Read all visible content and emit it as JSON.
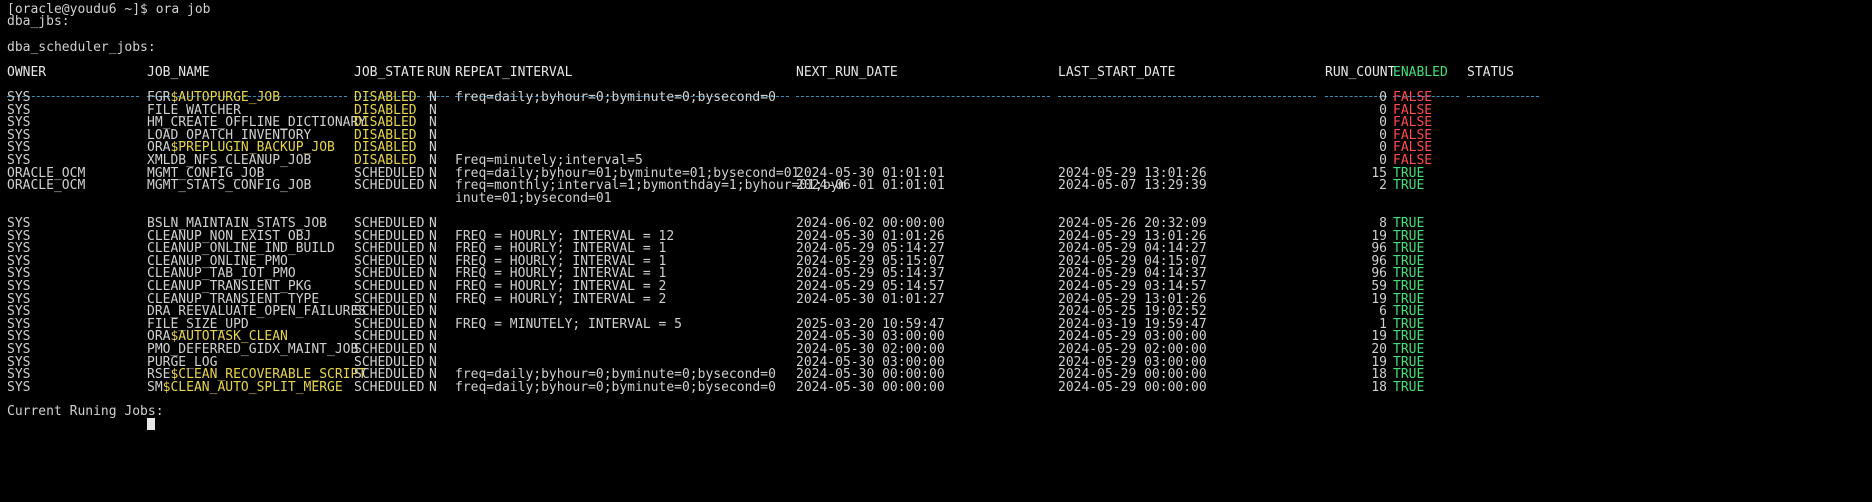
{
  "terminal": {
    "prompt": "[oracle@youdu6 ~]$ ora job",
    "heading_jbs": "dba_jbs:",
    "heading_scheduler": "dba_scheduler_jobs:",
    "footer": "Current Runing Jobs:"
  },
  "colors": {
    "background": "#000000",
    "text": "#d0d0d0",
    "disabled": "#e6d44a",
    "false": "#ff4b4b",
    "true": "#3fe07a",
    "separator": "#3a8fb8"
  },
  "columns": {
    "owner": "OWNER",
    "job_name": "JOB_NAME",
    "job_state": "JOB_STATE",
    "run": "RUN",
    "repeat_interval": "REPEAT_INTERVAL",
    "next_run_date": "NEXT_RUN_DATE",
    "last_start_date": "LAST_START_DATE",
    "run_count": "RUN_COUNT",
    "enabled": "ENABLED",
    "status": "STATUS"
  },
  "rows": [
    {
      "owner": "SYS",
      "job_prefix": "FGR",
      "job_suffix": "$AUTOPURGE_JOB",
      "state": "DISABLED",
      "run": "N",
      "repeat": "freq=daily;byhour=0;byminute=0;bysecond=0",
      "next": "",
      "last": "",
      "count": "0",
      "enabled": "FALSE"
    },
    {
      "owner": "SYS",
      "job_prefix": "FILE_WATCHER",
      "job_suffix": "",
      "state": "DISABLED",
      "run": "N",
      "repeat": "",
      "next": "",
      "last": "",
      "count": "0",
      "enabled": "FALSE"
    },
    {
      "owner": "SYS",
      "job_prefix": "HM_CREATE_OFFLINE_DICTIONARY",
      "job_suffix": "",
      "state": "DISABLED",
      "run": "N",
      "repeat": "",
      "next": "",
      "last": "",
      "count": "0",
      "enabled": "FALSE"
    },
    {
      "owner": "SYS",
      "job_prefix": "LOAD_OPATCH_INVENTORY",
      "job_suffix": "",
      "state": "DISABLED",
      "run": "N",
      "repeat": "",
      "next": "",
      "last": "",
      "count": "0",
      "enabled": "FALSE"
    },
    {
      "owner": "SYS",
      "job_prefix": "ORA",
      "job_suffix": "$PREPLUGIN_BACKUP_JOB",
      "state": "DISABLED",
      "run": "N",
      "repeat": "",
      "next": "",
      "last": "",
      "count": "0",
      "enabled": "FALSE"
    },
    {
      "owner": "SYS",
      "job_prefix": "XMLDB_NFS_CLEANUP_JOB",
      "job_suffix": "",
      "state": "DISABLED",
      "run": "N",
      "repeat": "Freq=minutely;interval=5",
      "next": "",
      "last": "",
      "count": "0",
      "enabled": "FALSE"
    },
    {
      "owner": "ORACLE_OCM",
      "job_prefix": "MGMT_CONFIG_JOB",
      "job_suffix": "",
      "state": "SCHEDULED",
      "run": "N",
      "repeat": "freq=daily;byhour=01;byminute=01;bysecond=01",
      "next": "2024-05-30 01:01:01",
      "last": "2024-05-29 13:01:26",
      "count": "15",
      "enabled": "TRUE"
    },
    {
      "owner": "ORACLE_OCM",
      "job_prefix": "MGMT_STATS_CONFIG_JOB",
      "job_suffix": "",
      "state": "SCHEDULED",
      "run": "N",
      "repeat": "freq=monthly;interval=1;bymonthday=1;byhour=01;bym",
      "repeat2": "inute=01;bysecond=01",
      "next": "2024-06-01 01:01:01",
      "last": "2024-05-07 13:29:39",
      "count": "2",
      "enabled": "TRUE"
    },
    {
      "owner": "SYS",
      "job_prefix": "BSLN_MAINTAIN_STATS_JOB",
      "job_suffix": "",
      "state": "SCHEDULED",
      "run": "N",
      "repeat": "",
      "next": "2024-06-02 00:00:00",
      "last": "2024-05-26 20:32:09",
      "count": "8",
      "enabled": "TRUE"
    },
    {
      "owner": "SYS",
      "job_prefix": "CLEANUP_NON_EXIST_OBJ",
      "job_suffix": "",
      "state": "SCHEDULED",
      "run": "N",
      "repeat": "FREQ = HOURLY; INTERVAL = 12",
      "next": "2024-05-30 01:01:26",
      "last": "2024-05-29 13:01:26",
      "count": "19",
      "enabled": "TRUE"
    },
    {
      "owner": "SYS",
      "job_prefix": "CLEANUP_ONLINE_IND_BUILD",
      "job_suffix": "",
      "state": "SCHEDULED",
      "run": "N",
      "repeat": "FREQ = HOURLY; INTERVAL = 1",
      "next": "2024-05-29 05:14:27",
      "last": "2024-05-29 04:14:27",
      "count": "96",
      "enabled": "TRUE"
    },
    {
      "owner": "SYS",
      "job_prefix": "CLEANUP_ONLINE_PMO",
      "job_suffix": "",
      "state": "SCHEDULED",
      "run": "N",
      "repeat": "FREQ = HOURLY; INTERVAL = 1",
      "next": "2024-05-29 05:15:07",
      "last": "2024-05-29 04:15:07",
      "count": "96",
      "enabled": "TRUE"
    },
    {
      "owner": "SYS",
      "job_prefix": "CLEANUP_TAB_IOT_PMO",
      "job_suffix": "",
      "state": "SCHEDULED",
      "run": "N",
      "repeat": "FREQ = HOURLY; INTERVAL = 1",
      "next": "2024-05-29 05:14:37",
      "last": "2024-05-29 04:14:37",
      "count": "96",
      "enabled": "TRUE"
    },
    {
      "owner": "SYS",
      "job_prefix": "CLEANUP_TRANSIENT_PKG",
      "job_suffix": "",
      "state": "SCHEDULED",
      "run": "N",
      "repeat": "FREQ = HOURLY; INTERVAL = 2",
      "next": "2024-05-29 05:14:57",
      "last": "2024-05-29 03:14:57",
      "count": "59",
      "enabled": "TRUE"
    },
    {
      "owner": "SYS",
      "job_prefix": "CLEANUP_TRANSIENT_TYPE",
      "job_suffix": "",
      "state": "SCHEDULED",
      "run": "N",
      "repeat": "FREQ = HOURLY; INTERVAL = 2",
      "next": "2024-05-30 01:01:27",
      "last": "2024-05-29 13:01:26",
      "count": "19",
      "enabled": "TRUE"
    },
    {
      "owner": "SYS",
      "job_prefix": "DRA_REEVALUATE_OPEN_FAILURES",
      "job_suffix": "",
      "state": "SCHEDULED",
      "run": "N",
      "repeat": "",
      "next": "",
      "last": "2024-05-25 19:02:52",
      "count": "6",
      "enabled": "TRUE"
    },
    {
      "owner": "SYS",
      "job_prefix": "FILE_SIZE_UPD",
      "job_suffix": "",
      "state": "SCHEDULED",
      "run": "N",
      "repeat": "FREQ = MINUTELY; INTERVAL = 5",
      "next": "2025-03-20 10:59:47",
      "last": "2024-03-19 19:59:47",
      "count": "1",
      "enabled": "TRUE"
    },
    {
      "owner": "SYS",
      "job_prefix": "ORA",
      "job_suffix": "$AUTOTASK_CLEAN",
      "state": "SCHEDULED",
      "run": "N",
      "repeat": "",
      "next": "2024-05-30 03:00:00",
      "last": "2024-05-29 03:00:00",
      "count": "19",
      "enabled": "TRUE"
    },
    {
      "owner": "SYS",
      "job_prefix": "PMO_DEFERRED_GIDX_MAINT_JOB",
      "job_suffix": "",
      "state": "SCHEDULED",
      "run": "N",
      "repeat": "",
      "next": "2024-05-30 02:00:00",
      "last": "2024-05-29 02:00:00",
      "count": "20",
      "enabled": "TRUE"
    },
    {
      "owner": "SYS",
      "job_prefix": "PURGE_LOG",
      "job_suffix": "",
      "state": "SCHEDULED",
      "run": "N",
      "repeat": "",
      "next": "2024-05-30 03:00:00",
      "last": "2024-05-29 03:00:00",
      "count": "19",
      "enabled": "TRUE"
    },
    {
      "owner": "SYS",
      "job_prefix": "RSE",
      "job_suffix": "$CLEAN_RECOVERABLE_SCRIPT",
      "state": "SCHEDULED",
      "run": "N",
      "repeat": "freq=daily;byhour=0;byminute=0;bysecond=0",
      "next": "2024-05-30 00:00:00",
      "last": "2024-05-29 00:00:00",
      "count": "18",
      "enabled": "TRUE"
    },
    {
      "owner": "SYS",
      "job_prefix": "SM",
      "job_suffix": "$CLEAN_AUTO_SPLIT_MERGE",
      "state": "SCHEDULED",
      "run": "N",
      "repeat": "freq=daily;byhour=0;byminute=0;bysecond=0",
      "next": "2024-05-30 00:00:00",
      "last": "2024-05-29 00:00:00",
      "count": "18",
      "enabled": "TRUE"
    }
  ]
}
